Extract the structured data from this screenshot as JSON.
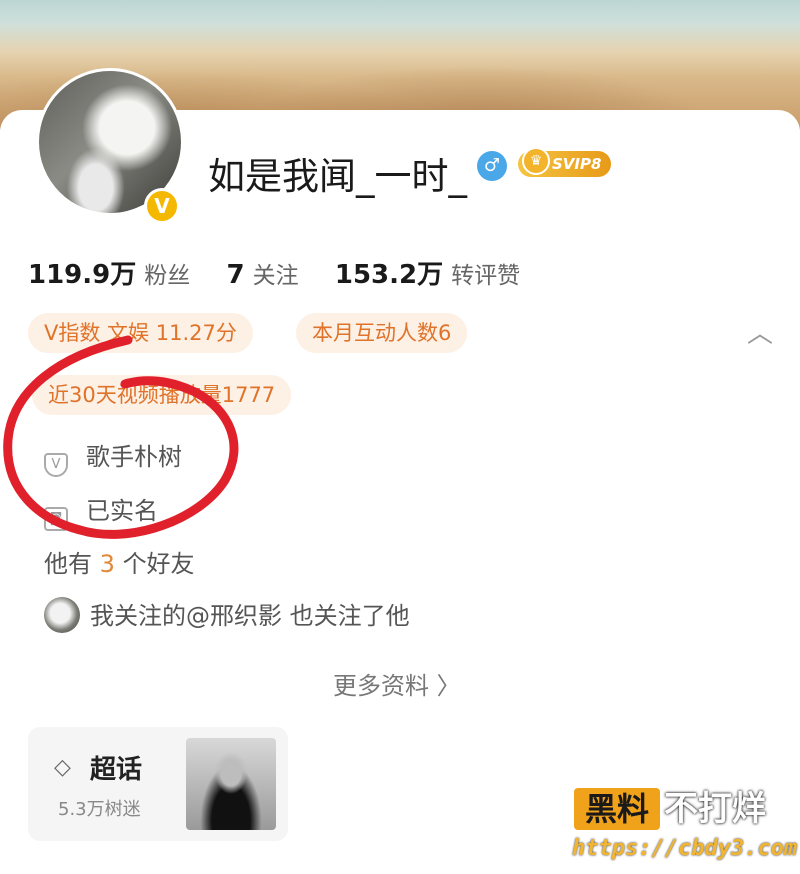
{
  "profile": {
    "username": "如是我闻_一时_",
    "gender_symbol": "♂",
    "verified_mark": "V",
    "svip_label": "SVIP8"
  },
  "stats": [
    {
      "value": "119.9万",
      "label": "粉丝"
    },
    {
      "value": "7",
      "label": "关注"
    },
    {
      "value": "153.2万",
      "label": "转评赞"
    }
  ],
  "tags": {
    "v_index": "V指数 文娱 11.27分",
    "monthly_interaction": "本月互动人数6",
    "video_plays": "近30天视频播放量1777"
  },
  "info": {
    "verification": "歌手朴树",
    "real_name": "已实名"
  },
  "friends": {
    "prefix": "他有",
    "count": "3",
    "suffix": "个好友"
  },
  "mutual_follow": "我关注的@邢织影 也关注了他",
  "more_info": "更多资料",
  "super_topic": {
    "title": "超话",
    "count": "5.3万树迷"
  },
  "watermark": {
    "badge": "黑料",
    "text": "不打烊",
    "url": "https://cbdy3.com"
  },
  "colors": {
    "tag_bg": "#fdf0e5",
    "tag_text": "#e0732a",
    "annotation_red": "#e0202a",
    "gender_blue": "#4aa7e8",
    "verified_gold": "#f5b800"
  }
}
